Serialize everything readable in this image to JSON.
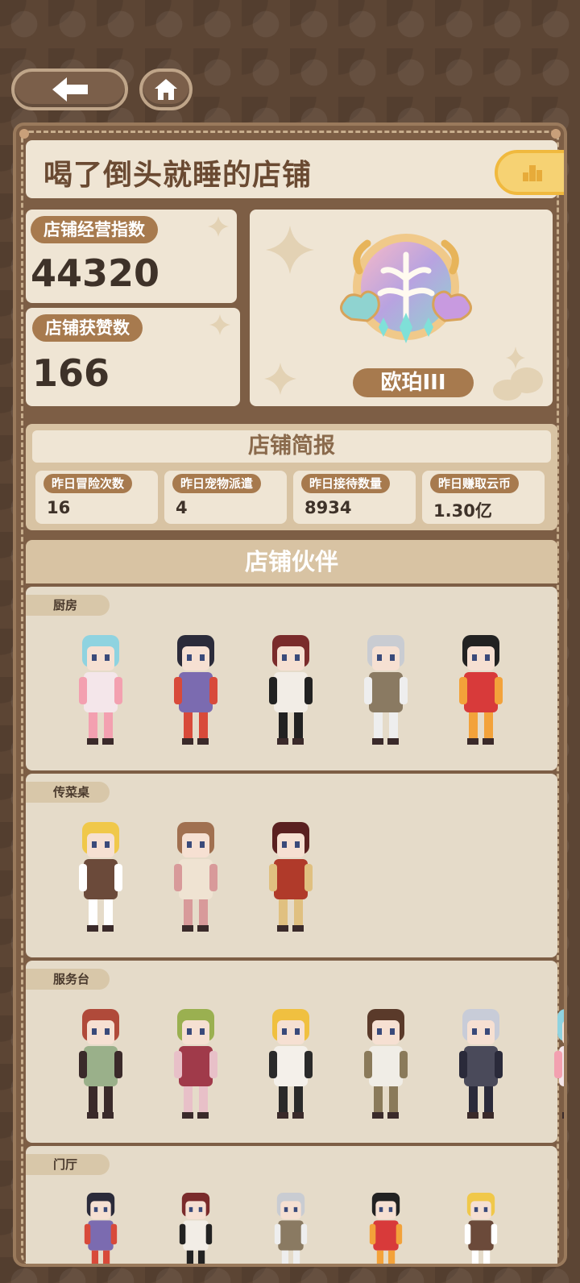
{
  "nav": {
    "back_icon": "back-arrow-icon",
    "home_icon": "home-icon"
  },
  "shop": {
    "title": "喝了倒头就睡的店铺",
    "rank_icon": "ranking-icon"
  },
  "stats": {
    "score_label": "店铺经营指数",
    "score_value": "44320",
    "likes_label": "店铺获赞数",
    "likes_value": "166"
  },
  "badge": {
    "name": "欧珀III",
    "icon": "opal-tree-badge-icon"
  },
  "brief": {
    "title": "店铺简报",
    "items": [
      {
        "label": "昨日冒险次数",
        "value": "16"
      },
      {
        "label": "昨日宠物派遣",
        "value": "4"
      },
      {
        "label": "昨日接待数量",
        "value": "8934"
      },
      {
        "label": "昨日赚取云币",
        "value": "1.30亿"
      }
    ]
  },
  "partners": {
    "title": "店铺伙伴",
    "sections": [
      {
        "name": "厨房",
        "count": 5
      },
      {
        "name": "传菜桌",
        "count": 3
      },
      {
        "name": "服务台",
        "count": 6
      },
      {
        "name": "门厅",
        "count": 5
      }
    ]
  },
  "colors": {
    "brand_brown": "#a77a4e",
    "panel": "#efe5d4",
    "gold": "#f6d273"
  }
}
